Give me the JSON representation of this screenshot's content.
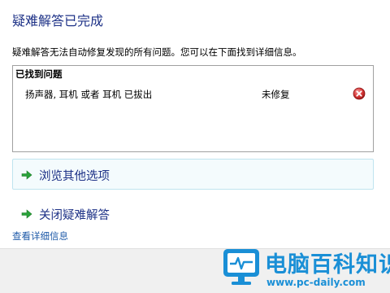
{
  "header": {
    "title": "疑难解答已完成"
  },
  "description": "疑难解答无法自动修复发现的所有问题。您可以在下面找到详细信息。",
  "problems": {
    "header": "已找到问题",
    "items": [
      {
        "name": "扬声器, 耳机 或者 耳机 已拔出",
        "status": "未修复",
        "icon": "error-icon"
      }
    ]
  },
  "commands": {
    "browse_label": "浏览其他选项",
    "close_label": "关闭疑难解答"
  },
  "details_link": "查看详细信息",
  "watermark": {
    "title": "电脑百科知识",
    "url": "www.pc-daily.com"
  },
  "colors": {
    "title": "#1e3287",
    "link": "#1e5aa8",
    "arrow": "#2aa33a",
    "error": "#d93a3a",
    "watermark": "#1a8fd6"
  }
}
